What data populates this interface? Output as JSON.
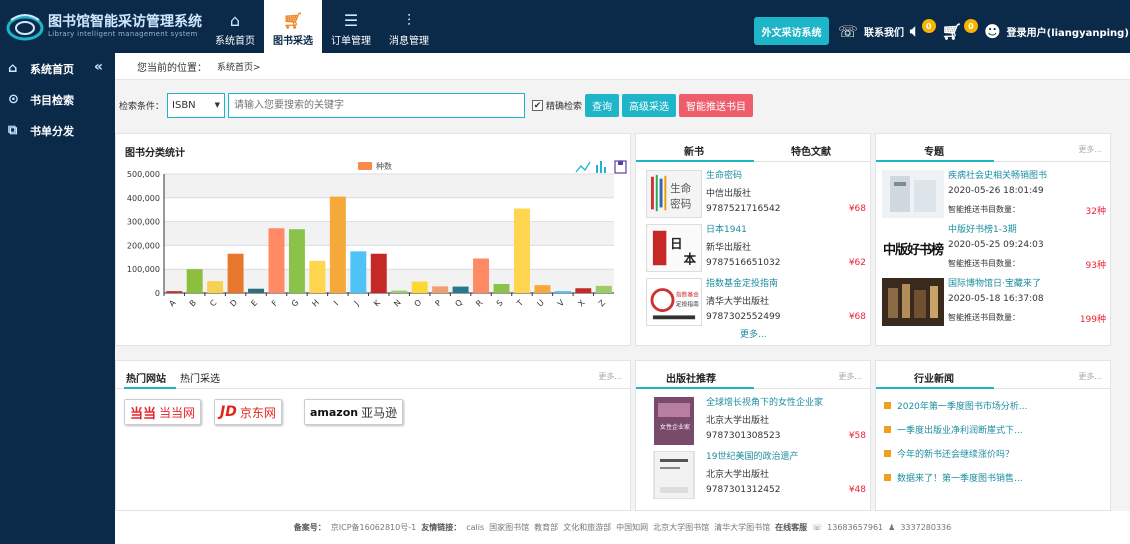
{
  "header": {
    "title": "图书馆智能采访管理系统",
    "subtitle": "Library intelligent management system",
    "nav": [
      {
        "label": "系统首页",
        "icon": "home-icon"
      },
      {
        "label": "图书采选",
        "icon": "cart-icon"
      },
      {
        "label": "订单管理",
        "icon": "list-icon"
      },
      {
        "label": "消息管理",
        "icon": "sliders-icon"
      }
    ],
    "foreign_button": "外文采访系统",
    "contact": "联系我们",
    "sound_badge": "0",
    "cart_badge": "0",
    "user": "登录用户(liangyanping)"
  },
  "sidebar": {
    "items": [
      {
        "label": "系统首页",
        "icon": "home-icon"
      },
      {
        "label": "书目检索",
        "icon": "search-icon"
      },
      {
        "label": "书单分发",
        "icon": "share-icon"
      }
    ]
  },
  "breadcrumb": {
    "prefix": "您当前的位置：",
    "current": "系统首页>"
  },
  "search": {
    "label": "检索条件：",
    "select_value": "ISBN",
    "placeholder": "请输入您要搜索的关键字",
    "exact_label": "精确检索",
    "query_btn": "查询",
    "advanced_btn": "高级采选",
    "push_btn": "智能推送书目"
  },
  "chart_panel": {
    "title": "图书分类统计"
  },
  "chart_data": {
    "type": "bar",
    "legend": "种数",
    "categories": [
      "A",
      "B",
      "C",
      "D",
      "E",
      "F",
      "G",
      "H",
      "I",
      "J",
      "K",
      "N",
      "O",
      "P",
      "Q",
      "R",
      "S",
      "T",
      "U",
      "V",
      "X",
      "Z"
    ],
    "values": [
      8000,
      100000,
      50000,
      165000,
      18000,
      272000,
      268000,
      135000,
      405000,
      175000,
      165000,
      10000,
      48000,
      28000,
      27000,
      145000,
      38000,
      355000,
      33000,
      8000,
      20000,
      30000
    ],
    "colors": [
      "#c23531",
      "#8bbf3c",
      "#f7d154",
      "#e8762b",
      "#2e6f7e",
      "#ff8a65",
      "#8bc34a",
      "#ffd54f",
      "#f4a93a",
      "#4fc3f7",
      "#c62828",
      "#9ccc65",
      "#fdd835",
      "#f0a070",
      "#26788c",
      "#ff8a65",
      "#8bc34a",
      "#ffd54f",
      "#f4a93a",
      "#4fc3f7",
      "#c62828",
      "#9ccc65"
    ],
    "yticks": [
      "500,000",
      "400,000",
      "300,000",
      "200,000",
      "100,000",
      "0"
    ],
    "ylim": [
      0,
      500000
    ]
  },
  "new_books": {
    "tabs": [
      "新书",
      "特色文献"
    ],
    "items": [
      {
        "title": "生命密码",
        "publisher": "中信出版社",
        "isbn": "9787521716542",
        "price": "¥68"
      },
      {
        "title": "日本1941",
        "publisher": "新华出版社",
        "isbn": "9787516651032",
        "price": "¥62"
      },
      {
        "title": "指数基金定投指南",
        "publisher": "清华大学出版社",
        "isbn": "9787302552499",
        "price": "¥68"
      }
    ],
    "more": "更多..."
  },
  "special": {
    "title": "专题",
    "more": "更多...",
    "items": [
      {
        "title": "疾病社会史相关畅销图书",
        "date": "2020-05-26 18:01:49",
        "count_label": "智能推送书目数量：",
        "count": "32种"
      },
      {
        "title": "中版好书榜1-3期",
        "date": "2020-05-25 09:24:03",
        "count_label": "智能推送书目数量：",
        "count": "93种"
      },
      {
        "title": "国际博物馆日·宝藏来了",
        "date": "2020-05-18 16:37:08",
        "count_label": "智能推送书目数量：",
        "count": "199种"
      }
    ],
    "cover2_text": "中版好书榜"
  },
  "hot_sites": {
    "tabs": [
      "热门网站",
      "热门采选"
    ],
    "more": "更多...",
    "sites": [
      "当当网",
      "京东网",
      "亚马逊"
    ],
    "dang_logo": "当当",
    "jd_logo": "JD",
    "amazon_logo": "amazon"
  },
  "publisher_rec": {
    "title": "出版社推荐",
    "more": "更多...",
    "items": [
      {
        "title": "全球增长视角下的女性企业家",
        "publisher": "北京大学出版社",
        "isbn": "9787301308523",
        "price": "¥58"
      },
      {
        "title": "19世纪美国的政治遗产",
        "publisher": "北京大学出版社",
        "isbn": "9787301312452",
        "price": "¥48"
      }
    ]
  },
  "industry_news": {
    "title": "行业新闻",
    "more": "更多...",
    "items": [
      "2020年第一季度图书市场分析...",
      "一季度出版业净利润断崖式下...",
      "今年的新书还会继续涨价吗？",
      "数据来了！第一季度图书销售..."
    ]
  },
  "footer": {
    "record_label": "备案号：",
    "record": "京ICP备16062810号-1",
    "links_label": "友情链接：",
    "links": [
      "calis",
      "国家图书馆",
      "教育部",
      "文化和旅游部",
      "中国知网",
      "北京大学图书馆",
      "清华大学图书馆"
    ],
    "service_label": "在线客服",
    "phone": "13683657961",
    "qq": "3337280336"
  },
  "colors": {
    "navy": "#0b2a4a",
    "teal": "#1eb5c9",
    "red": "#ee5d6c",
    "orange": "#f08a2c"
  }
}
